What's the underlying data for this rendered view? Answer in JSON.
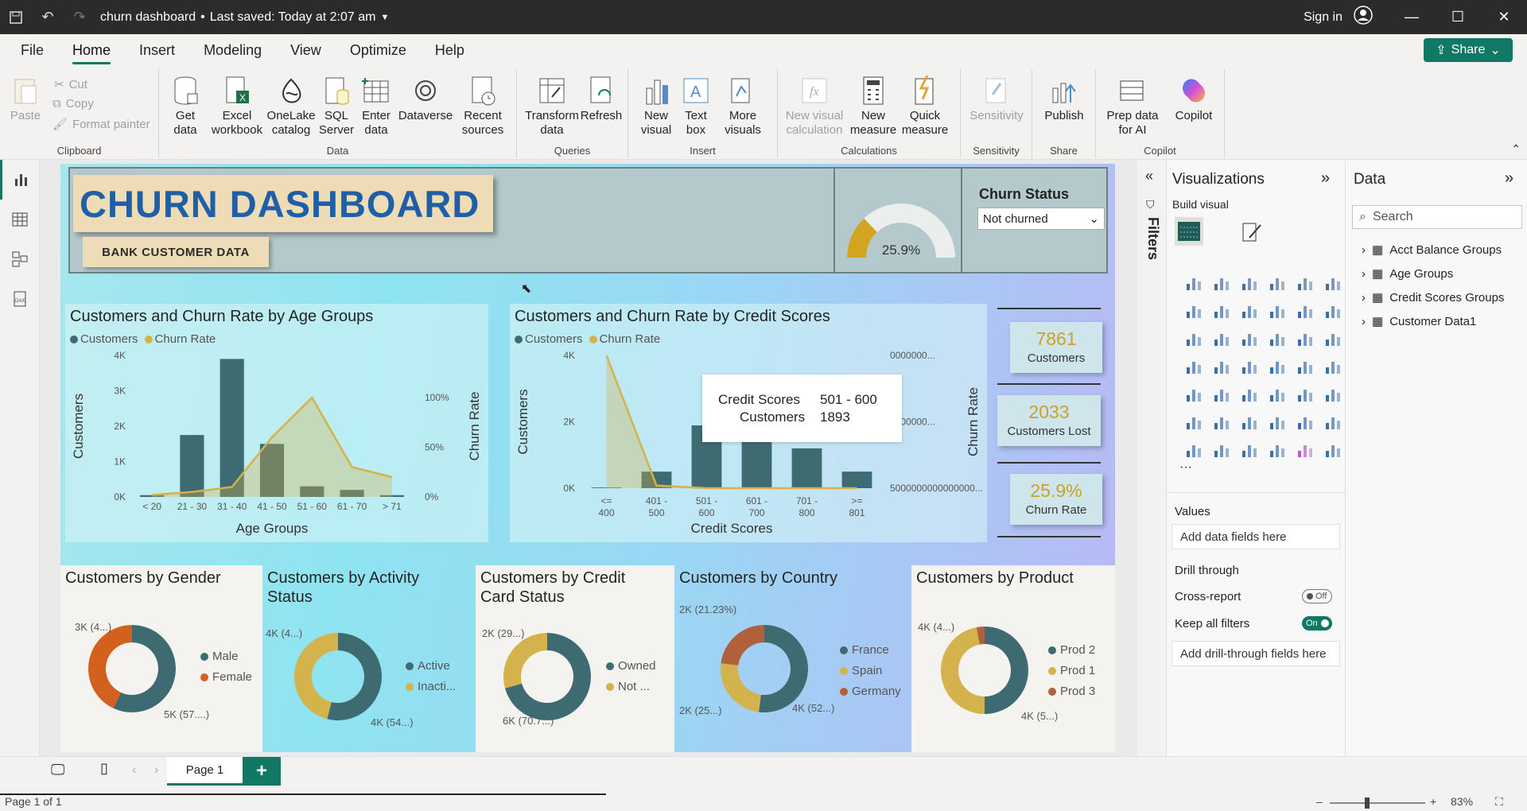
{
  "titlebar": {
    "doc_title": "churn dashboard",
    "saved": "Last saved: Today at 2:07 am",
    "sign_in": "Sign in"
  },
  "menu": [
    "File",
    "Home",
    "Insert",
    "Modeling",
    "View",
    "Optimize",
    "Help"
  ],
  "share": "Share",
  "ribbon": {
    "clipboard": {
      "paste": "Paste",
      "cut": "Cut",
      "copy": "Copy",
      "format_painter": "Format painter",
      "label": "Clipboard"
    },
    "data": {
      "get_data": "Get data",
      "excel": "Excel workbook",
      "onelake": "OneLake catalog",
      "sql": "SQL Server",
      "enter": "Enter data",
      "dataverse": "Dataverse",
      "recent": "Recent sources",
      "label": "Data"
    },
    "queries": {
      "transform": "Transform data",
      "refresh": "Refresh",
      "label": "Queries"
    },
    "insert": {
      "new_visual": "New visual",
      "text_box": "Text box",
      "more_visuals": "More visuals",
      "label": "Insert"
    },
    "calculations": {
      "new_visual_calc": "New visual calculation",
      "new_measure": "New measure",
      "quick_measure": "Quick measure",
      "label": "Calculations"
    },
    "sensitivity": {
      "btn": "Sensitivity",
      "label": "Sensitivity"
    },
    "share_group": {
      "publish": "Publish",
      "label": "Share"
    },
    "copilot": {
      "prep": "Prep data for AI",
      "copilot": "Copilot",
      "label": "Copilot"
    }
  },
  "dashboard": {
    "title": "CHURN DASHBOARD",
    "subtitle": "BANK CUSTOMER DATA",
    "gauge_value": "25.9%",
    "slicer": {
      "title": "Churn Status",
      "value": "Not churned"
    },
    "kpis": [
      {
        "value": "7861",
        "label": "Customers"
      },
      {
        "value": "2033",
        "label": "Customers Lost"
      },
      {
        "value": "25.9%",
        "label": "Churn Rate"
      }
    ]
  },
  "chart_data": [
    {
      "type": "bar",
      "title": "Customers and Churn Rate by Age Groups",
      "legend": [
        "Customers",
        "Churn Rate"
      ],
      "categories": [
        "< 20",
        "21 - 30",
        "31 - 40",
        "41 - 50",
        "51 - 60",
        "61 - 70",
        "> 71"
      ],
      "series": [
        {
          "name": "Customers",
          "values": [
            50,
            1750,
            3900,
            1500,
            300,
            200,
            50
          ]
        },
        {
          "name": "Churn Rate",
          "values": [
            0.02,
            0.05,
            0.1,
            0.6,
            1.0,
            0.3,
            0.2
          ]
        }
      ],
      "xlabel": "Age Groups",
      "ylabel": "Customers",
      "y2label": "Churn Rate",
      "yticks": [
        "4K",
        "3K",
        "2K",
        "1K",
        "0K"
      ],
      "y2ticks": [
        "100%",
        "50%",
        "0%"
      ],
      "ylim": [
        0,
        4000
      ]
    },
    {
      "type": "bar",
      "title": "Customers and Churn Rate by Credit Scores",
      "legend": [
        "Customers",
        "Churn Rate"
      ],
      "categories": [
        "<= 400",
        "401 - 500",
        "501 - 600",
        "601 - 700",
        "701 - 800",
        ">= 801"
      ],
      "series": [
        {
          "name": "Customers",
          "values": [
            20,
            500,
            1893,
            2500,
            1200,
            500
          ]
        },
        {
          "name": "Churn Rate",
          "values": [
            1.0,
            0.02,
            0.0,
            0.0,
            0.0,
            0.0
          ]
        }
      ],
      "xlabel": "Credit Scores",
      "ylabel": "Customers",
      "y2label": "Churn Rate",
      "yticks": [
        "4K",
        "2K",
        "0K"
      ],
      "y2ticks": [
        "0000000...",
        "0000000...",
        "5000000000000000..."
      ],
      "ylim": [
        0,
        4000
      ],
      "tooltip": {
        "k1": "Credit Scores",
        "v1": "501 - 600",
        "k2": "Customers",
        "v2": "1893"
      }
    },
    {
      "type": "pie",
      "title": "Customers by Gender",
      "categories": [
        "Male",
        "Female"
      ],
      "values": [
        57,
        43
      ],
      "labels": [
        "5K (57....)",
        "3K (4...)"
      ],
      "colors": [
        "#3e6b72",
        "#d4601e"
      ]
    },
    {
      "type": "pie",
      "title": "Customers by Activity Status",
      "categories": [
        "Active",
        "Inacti..."
      ],
      "values": [
        54,
        46
      ],
      "labels": [
        "4K (54...)",
        "4K (4...)"
      ],
      "colors": [
        "#3e6b72",
        "#d4b24c"
      ]
    },
    {
      "type": "pie",
      "title": "Customers by Credit Card Status",
      "categories": [
        "Owned",
        "Not ..."
      ],
      "values": [
        70.7,
        29.3
      ],
      "labels": [
        "6K (70.7...)",
        "2K (29...)"
      ],
      "colors": [
        "#3e6b72",
        "#d4b24c"
      ]
    },
    {
      "type": "pie",
      "title": "Customers by Country",
      "categories": [
        "France",
        "Spain",
        "Germany"
      ],
      "values": [
        52,
        25,
        23
      ],
      "labels": [
        "4K (52...)",
        "2K (25...)",
        "2K (21.23%)"
      ],
      "colors": [
        "#3e6b72",
        "#d4b24c",
        "#b0603a"
      ]
    },
    {
      "type": "pie",
      "title": "Customers by Product",
      "categories": [
        "Prod 2",
        "Prod 1",
        "Prod 3"
      ],
      "values": [
        50,
        47,
        3
      ],
      "labels": [
        "4K (5...)",
        "4K (4...)"
      ],
      "colors": [
        "#3e6b72",
        "#d4b24c",
        "#b0603a"
      ]
    }
  ],
  "visualizations": {
    "title": "Visualizations",
    "build": "Build visual",
    "values": "Values",
    "add_fields": "Add data fields here",
    "drill": "Drill through",
    "cross": "Cross-report",
    "cross_state": "Off",
    "keep": "Keep all filters",
    "keep_state": "On",
    "add_drill": "Add drill-through fields here"
  },
  "filters": "Filters",
  "data_pane": {
    "title": "Data",
    "search": "Search",
    "tables": [
      "Acct Balance Groups",
      "Age Groups",
      "Credit Scores Groups",
      "Customer Data1"
    ]
  },
  "pages": {
    "tab": "Page 1",
    "add": "+"
  },
  "status": {
    "page": "Page 1 of 1",
    "zoom": "83%"
  }
}
